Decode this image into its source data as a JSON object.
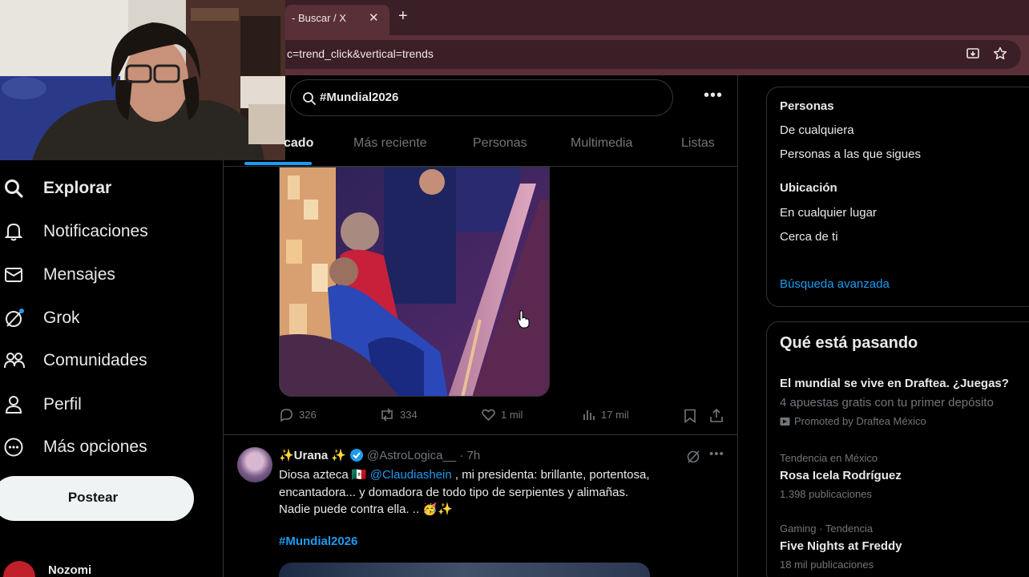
{
  "browser": {
    "tab_title": "- Buscar / X",
    "tab_close": "✕",
    "new_tab": "+",
    "url": "c=trend_click&vertical=trends"
  },
  "nav": {
    "items": [
      {
        "label": "Explorar",
        "icon": "search-icon"
      },
      {
        "label": "Notificaciones",
        "icon": "bell-icon"
      },
      {
        "label": "Mensajes",
        "icon": "envelope-icon"
      },
      {
        "label": "Grok",
        "icon": "grok-icon"
      },
      {
        "label": "Comunidades",
        "icon": "people-icon"
      },
      {
        "label": "Perfil",
        "icon": "person-icon"
      },
      {
        "label": "Más opciones",
        "icon": "more-circle-icon"
      }
    ],
    "post_button": "Postear",
    "profile_name": "Nozomi"
  },
  "search": {
    "query": "#Mundial2026",
    "more": "•••"
  },
  "tabs": [
    {
      "label": "cado",
      "active": true
    },
    {
      "label": "Más reciente",
      "active": false
    },
    {
      "label": "Personas",
      "active": false
    },
    {
      "label": "Multimedia",
      "active": false
    },
    {
      "label": "Listas",
      "active": false
    }
  ],
  "post1_actions": {
    "replies": "326",
    "reposts": "334",
    "likes": "1 mil",
    "views": "17 mil"
  },
  "post2": {
    "name": "✨Urana ✨",
    "handle": "@AstroLogica__ · 7h",
    "text_line1_a": "Diosa azteca 🇲🇽 ",
    "mention": "@Claudiashein",
    "text_line1_b": " , mi presidenta: brillante, portentosa,",
    "text_line2": "encantadora...  y domadora de todo tipo de serpientes y alimañas.",
    "text_line3": "Nadie puede contra ella.  .. 🥳✨",
    "hashtag": "#Mundial2026"
  },
  "filters": {
    "people_heading": "Personas",
    "people_opt1": "De cualquiera",
    "people_opt2": "Personas a las que sigues",
    "location_heading": "Ubicación",
    "location_opt1": "En cualquier lugar",
    "location_opt2": "Cerca de ti",
    "advanced": "Búsqueda avanzada"
  },
  "trends": {
    "title": "Qué está pasando",
    "ad_title": "El mundial se vive en Draftea. ¿Juegas?",
    "ad_text": "4 apuestas gratis con tu primer depósito",
    "ad_promoted": "Promoted by Draftea México",
    "items": [
      {
        "context": "Tendencia en México",
        "name": "Rosa Icela Rodríguez",
        "count": "1.398 publicaciones"
      },
      {
        "context": "Gaming · Tendencia",
        "name": "Five Nights at Freddy",
        "count": "18 mil publicaciones"
      }
    ]
  },
  "colors": {
    "accent": "#1d9bf0",
    "browser_chrome": "#5a3038",
    "background": "#000000"
  }
}
